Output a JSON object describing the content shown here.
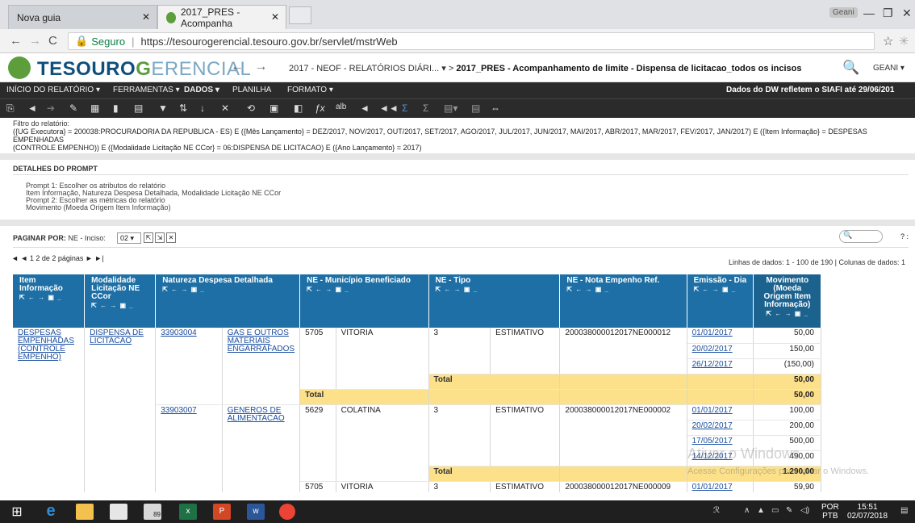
{
  "browser": {
    "tabs": [
      {
        "title": "Nova guia"
      },
      {
        "title": "2017_PRES - Acompanha"
      }
    ],
    "profile": "Geani",
    "secure_label": "Seguro",
    "url": "https://tesourogerencial.tesouro.gov.br/servlet/mstrWeb"
  },
  "app": {
    "logo_a": "TESOURO",
    "logo_b": "G",
    "logo_c": "ERENCIAL",
    "crumb_prefix": "2017 - NEOF - RELATÓRIOS DIÁRI...",
    "crumb_current": "2017_PRES - Acompanhamento de limite - Dispensa de licitacao_todos os incisos",
    "user": "GEANI"
  },
  "menu": {
    "items": [
      "INÍCIO DO RELATÓRIO ▾",
      "FERRAMENTAS ▾",
      "DADOS ▾",
      "PLANILHA",
      "FORMATO ▾"
    ],
    "dw_notice": "Dados do DW refletem o SIAFI até 29/06/201"
  },
  "toolbar": {
    "icons": [
      "save-icon",
      "undo-icon",
      "redo-icon",
      "edit-icon",
      "grid-icon",
      "bar-chart-icon",
      "grid-chart-icon",
      "filter-icon",
      "sort-icon",
      "sort-desc-icon",
      "clear-icon",
      "refresh-icon",
      "pivot-icon",
      "page-icon",
      "fx-icon",
      "abc-icon",
      "move-left-icon",
      "move-all-left-icon",
      "sum-icon",
      "sum-total-icon",
      "subtotal-icon",
      "subtotal-alt-icon",
      "link-icon"
    ],
    "glyphs": [
      "⎘",
      "◄",
      "➔",
      "✎",
      "▦",
      "▮",
      "▤",
      "▼",
      "⇅",
      "↓",
      "✕",
      "⟲",
      "▣",
      "◧",
      "ƒx",
      "alb",
      "◄",
      "◄◄",
      "Σ",
      "Σ",
      "▤▾",
      "▤",
      "⇔"
    ]
  },
  "filter": {
    "label": "Filtro do relatório:",
    "line1": "({UG Executora} = 200038:PROCURADORIA DA REPUBLICA - ES) E ({Mês Lançamento} = DEZ/2017, NOV/2017, OUT/2017, SET/2017, AGO/2017, JUL/2017, JUN/2017, MAI/2017, ABR/2017, MAR/2017, FEV/2017, JAN/2017) E ({Item Informação} = DESPESAS EMPENHADAS",
    "line2": "(CONTROLE EMPENHO)) E ({Modalidade Licitação NE CCor} = 06:DISPENSA DE LICITACAO) E ({Ano Lançamento} = 2017)"
  },
  "prompt": {
    "title": "DETALHES DO PROMPT",
    "lines": [
      "Prompt 1: Escolher os atributos do relatório",
      "Item Informação, Natureza Despesa Detalhada, Modalidade Licitação NE CCor",
      "Prompt 2: Escolher as métricas do relatório",
      "Movimento (Moeda Origem Item Informação)"
    ]
  },
  "paging": {
    "label": "PAGINAR POR:",
    "field": "NE - Inciso:",
    "value": "02 ▾",
    "pages": "◄ ◄ 1 2  de 2 páginas ► ►|",
    "rows_info": "Linhas de dados: 1 - 100 de 190  |  Colunas de dados: 1",
    "help": "? :"
  },
  "grid": {
    "headers": {
      "item": "Item Informação",
      "modalidade": "Modalidade Licitação NE CCor",
      "natureza": "Natureza Despesa Detalhada",
      "municipio": "NE - Município Beneficiado",
      "tipo": "NE - Tipo",
      "nota": "NE - Nota Empenho Ref.",
      "emissao": "Emissão - Dia",
      "movimento": "Movimento (Moeda Origem Item Informação)"
    },
    "header_icons": "⇱ ← → ▣ _",
    "item_value": "DESPESAS EMPENHADAS (CONTROLE EMPENHO)",
    "modalidade_value": "DISPENSA DE LICITACAO",
    "total_label": "Total",
    "block1": {
      "nat_code": "33903004",
      "nat_desc": "GAS E OUTROS MATERIAIS ENGARRAFADOS",
      "mun_code": "5705",
      "mun_name": "VITORIA",
      "tipo_code": "3",
      "tipo_name": "ESTIMATIVO",
      "nota": "200038000012017NE000012",
      "rows": [
        {
          "date": "01/01/2017",
          "value": "50,00"
        },
        {
          "date": "20/02/2017",
          "value": "150,00"
        },
        {
          "date": "26/12/2017",
          "value": "(150,00)"
        }
      ],
      "subtotal": "50,00",
      "total": "50,00"
    },
    "block2": {
      "nat_code": "33903007",
      "nat_desc": "GENEROS DE ALIMENTACAO",
      "mun_code": "5629",
      "mun_name": "COLATINA",
      "tipo_code": "3",
      "tipo_name": "ESTIMATIVO",
      "nota": "200038000012017NE000002",
      "rows": [
        {
          "date": "01/01/2017",
          "value": "100,00"
        },
        {
          "date": "20/02/2017",
          "value": "200,00"
        },
        {
          "date": "17/05/2017",
          "value": "500,00"
        },
        {
          "date": "14/12/2017",
          "value": "490,00"
        }
      ],
      "subtotal": "1.290,00"
    },
    "block3": {
      "mun_code": "5705",
      "mun_name": "VITORIA",
      "tipo_code": "3",
      "tipo_name": "ESTIMATIVO",
      "nota": "200038000012017NE000009",
      "date": "01/01/2017",
      "value": "59,90"
    }
  },
  "watermark": {
    "line1": "Ativar o Windows",
    "line2": "Acesse Configurações para ativar o Windows."
  },
  "taskbar": {
    "lang1": "POR",
    "lang2": "PTB",
    "time": "15:51",
    "date": "02/07/2018",
    "badge": "89"
  }
}
